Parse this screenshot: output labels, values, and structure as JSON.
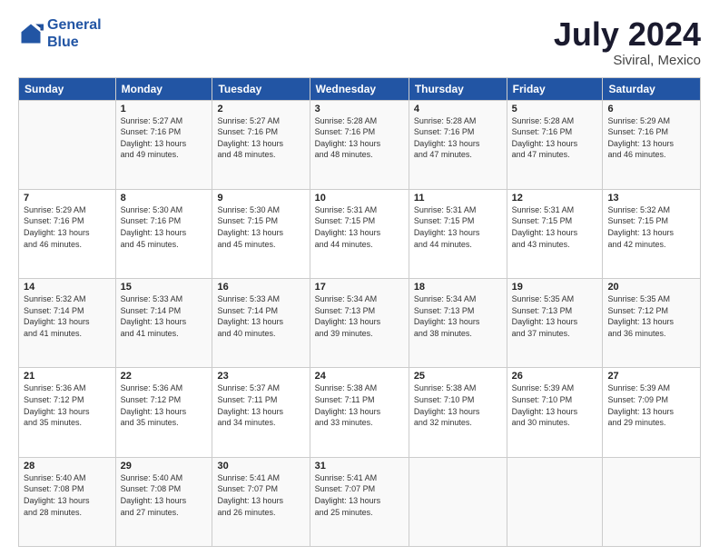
{
  "header": {
    "logo_line1": "General",
    "logo_line2": "Blue",
    "main_title": "July 2024",
    "subtitle": "Siviral, Mexico"
  },
  "calendar": {
    "days_of_week": [
      "Sunday",
      "Monday",
      "Tuesday",
      "Wednesday",
      "Thursday",
      "Friday",
      "Saturday"
    ],
    "weeks": [
      [
        {
          "day": "",
          "info": ""
        },
        {
          "day": "1",
          "info": "Sunrise: 5:27 AM\nSunset: 7:16 PM\nDaylight: 13 hours\nand 49 minutes."
        },
        {
          "day": "2",
          "info": "Sunrise: 5:27 AM\nSunset: 7:16 PM\nDaylight: 13 hours\nand 48 minutes."
        },
        {
          "day": "3",
          "info": "Sunrise: 5:28 AM\nSunset: 7:16 PM\nDaylight: 13 hours\nand 48 minutes."
        },
        {
          "day": "4",
          "info": "Sunrise: 5:28 AM\nSunset: 7:16 PM\nDaylight: 13 hours\nand 47 minutes."
        },
        {
          "day": "5",
          "info": "Sunrise: 5:28 AM\nSunset: 7:16 PM\nDaylight: 13 hours\nand 47 minutes."
        },
        {
          "day": "6",
          "info": "Sunrise: 5:29 AM\nSunset: 7:16 PM\nDaylight: 13 hours\nand 46 minutes."
        }
      ],
      [
        {
          "day": "7",
          "info": "Sunrise: 5:29 AM\nSunset: 7:16 PM\nDaylight: 13 hours\nand 46 minutes."
        },
        {
          "day": "8",
          "info": "Sunrise: 5:30 AM\nSunset: 7:16 PM\nDaylight: 13 hours\nand 45 minutes."
        },
        {
          "day": "9",
          "info": "Sunrise: 5:30 AM\nSunset: 7:15 PM\nDaylight: 13 hours\nand 45 minutes."
        },
        {
          "day": "10",
          "info": "Sunrise: 5:31 AM\nSunset: 7:15 PM\nDaylight: 13 hours\nand 44 minutes."
        },
        {
          "day": "11",
          "info": "Sunrise: 5:31 AM\nSunset: 7:15 PM\nDaylight: 13 hours\nand 44 minutes."
        },
        {
          "day": "12",
          "info": "Sunrise: 5:31 AM\nSunset: 7:15 PM\nDaylight: 13 hours\nand 43 minutes."
        },
        {
          "day": "13",
          "info": "Sunrise: 5:32 AM\nSunset: 7:15 PM\nDaylight: 13 hours\nand 42 minutes."
        }
      ],
      [
        {
          "day": "14",
          "info": "Sunrise: 5:32 AM\nSunset: 7:14 PM\nDaylight: 13 hours\nand 41 minutes."
        },
        {
          "day": "15",
          "info": "Sunrise: 5:33 AM\nSunset: 7:14 PM\nDaylight: 13 hours\nand 41 minutes."
        },
        {
          "day": "16",
          "info": "Sunrise: 5:33 AM\nSunset: 7:14 PM\nDaylight: 13 hours\nand 40 minutes."
        },
        {
          "day": "17",
          "info": "Sunrise: 5:34 AM\nSunset: 7:13 PM\nDaylight: 13 hours\nand 39 minutes."
        },
        {
          "day": "18",
          "info": "Sunrise: 5:34 AM\nSunset: 7:13 PM\nDaylight: 13 hours\nand 38 minutes."
        },
        {
          "day": "19",
          "info": "Sunrise: 5:35 AM\nSunset: 7:13 PM\nDaylight: 13 hours\nand 37 minutes."
        },
        {
          "day": "20",
          "info": "Sunrise: 5:35 AM\nSunset: 7:12 PM\nDaylight: 13 hours\nand 36 minutes."
        }
      ],
      [
        {
          "day": "21",
          "info": "Sunrise: 5:36 AM\nSunset: 7:12 PM\nDaylight: 13 hours\nand 35 minutes."
        },
        {
          "day": "22",
          "info": "Sunrise: 5:36 AM\nSunset: 7:12 PM\nDaylight: 13 hours\nand 35 minutes."
        },
        {
          "day": "23",
          "info": "Sunrise: 5:37 AM\nSunset: 7:11 PM\nDaylight: 13 hours\nand 34 minutes."
        },
        {
          "day": "24",
          "info": "Sunrise: 5:38 AM\nSunset: 7:11 PM\nDaylight: 13 hours\nand 33 minutes."
        },
        {
          "day": "25",
          "info": "Sunrise: 5:38 AM\nSunset: 7:10 PM\nDaylight: 13 hours\nand 32 minutes."
        },
        {
          "day": "26",
          "info": "Sunrise: 5:39 AM\nSunset: 7:10 PM\nDaylight: 13 hours\nand 30 minutes."
        },
        {
          "day": "27",
          "info": "Sunrise: 5:39 AM\nSunset: 7:09 PM\nDaylight: 13 hours\nand 29 minutes."
        }
      ],
      [
        {
          "day": "28",
          "info": "Sunrise: 5:40 AM\nSunset: 7:08 PM\nDaylight: 13 hours\nand 28 minutes."
        },
        {
          "day": "29",
          "info": "Sunrise: 5:40 AM\nSunset: 7:08 PM\nDaylight: 13 hours\nand 27 minutes."
        },
        {
          "day": "30",
          "info": "Sunrise: 5:41 AM\nSunset: 7:07 PM\nDaylight: 13 hours\nand 26 minutes."
        },
        {
          "day": "31",
          "info": "Sunrise: 5:41 AM\nSunset: 7:07 PM\nDaylight: 13 hours\nand 25 minutes."
        },
        {
          "day": "",
          "info": ""
        },
        {
          "day": "",
          "info": ""
        },
        {
          "day": "",
          "info": ""
        }
      ]
    ]
  }
}
